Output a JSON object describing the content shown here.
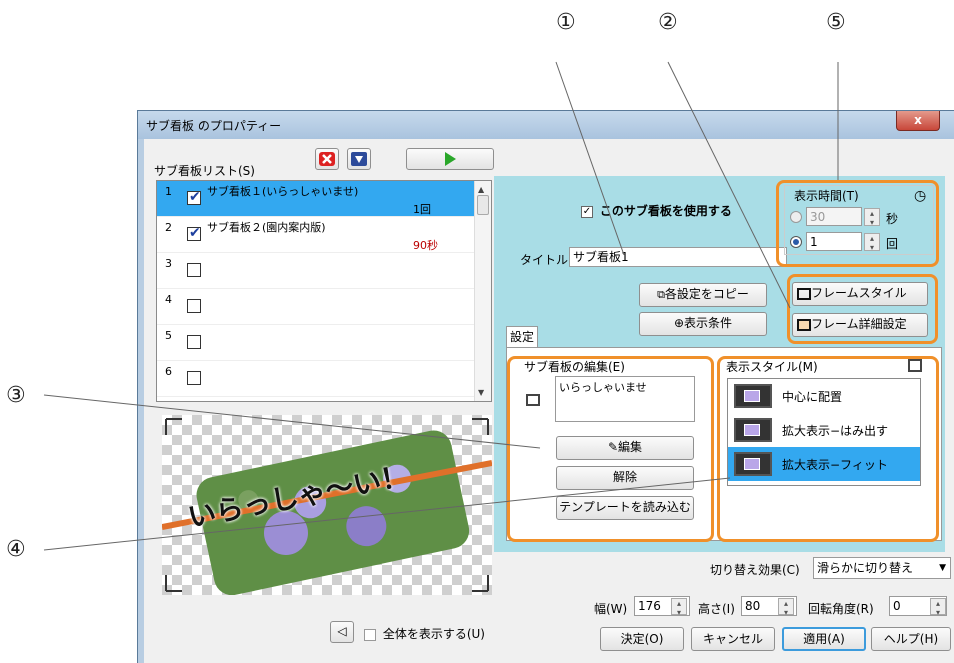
{
  "callouts": [
    "①",
    "②",
    "⑤",
    "③",
    "④"
  ],
  "window": {
    "title": "サブ看板 のプロパティー",
    "close": "x"
  },
  "list": {
    "label": "サブ看板リスト(S)",
    "items": [
      {
        "num": "1",
        "name": "サブ看板１(いらっしゃいませ)",
        "detail": "1回",
        "checked": true,
        "selected": true
      },
      {
        "num": "2",
        "name": "サブ看板２(園内案内版)",
        "detail": "90秒",
        "checked": true,
        "selected": false
      },
      {
        "num": "3",
        "name": "",
        "detail": "",
        "checked": false,
        "selected": false
      },
      {
        "num": "4",
        "name": "",
        "detail": "",
        "checked": false,
        "selected": false
      },
      {
        "num": "5",
        "name": "",
        "detail": "",
        "checked": false,
        "selected": false
      },
      {
        "num": "6",
        "name": "",
        "detail": "",
        "checked": false,
        "selected": false
      }
    ]
  },
  "preview": {
    "text": "いらっしゃ〜い！"
  },
  "bottom_left": {
    "show_all": "全体を表示する(U)"
  },
  "panel": {
    "use_checkbox": "このサブ看板を使用する",
    "title_label": "タイトル",
    "title_value": "サブ看板1",
    "copy_button": "各設定をコピー",
    "condition_button": "表示条件",
    "frame_style": "フレームスタイル",
    "frame_detail": "フレーム詳細設定",
    "display_time": {
      "label": "表示時間(T)",
      "seconds_value": "30",
      "seconds_unit": "秒",
      "count_value": "1",
      "count_unit": "回"
    },
    "tab": "設定",
    "edit_group": {
      "label": "サブ看板の編集(E)",
      "text": "いらっしゃいませ",
      "edit": "編集",
      "clear": "解除",
      "template": "テンプレートを読み込む"
    },
    "style_group": {
      "label": "表示スタイル(M)",
      "items": [
        "中心に配置",
        "拡大表示−はみ出す",
        "拡大表示−フィット"
      ]
    }
  },
  "bottom": {
    "switch_label": "切り替え効果(C)",
    "switch_value": "滑らかに切り替え",
    "width_label": "幅(W)",
    "width_value": "176",
    "height_label": "高さ(I)",
    "height_value": "80",
    "rotate_label": "回転角度(R)",
    "rotate_value": "0",
    "ok": "決定(O)",
    "cancel": "キャンセル",
    "apply": "適用(A)",
    "help": "ヘルプ(H)"
  },
  "colors": {
    "accent": "#f0902a",
    "panel_bg": "#a9dde6",
    "selection": "#33a8f0"
  }
}
